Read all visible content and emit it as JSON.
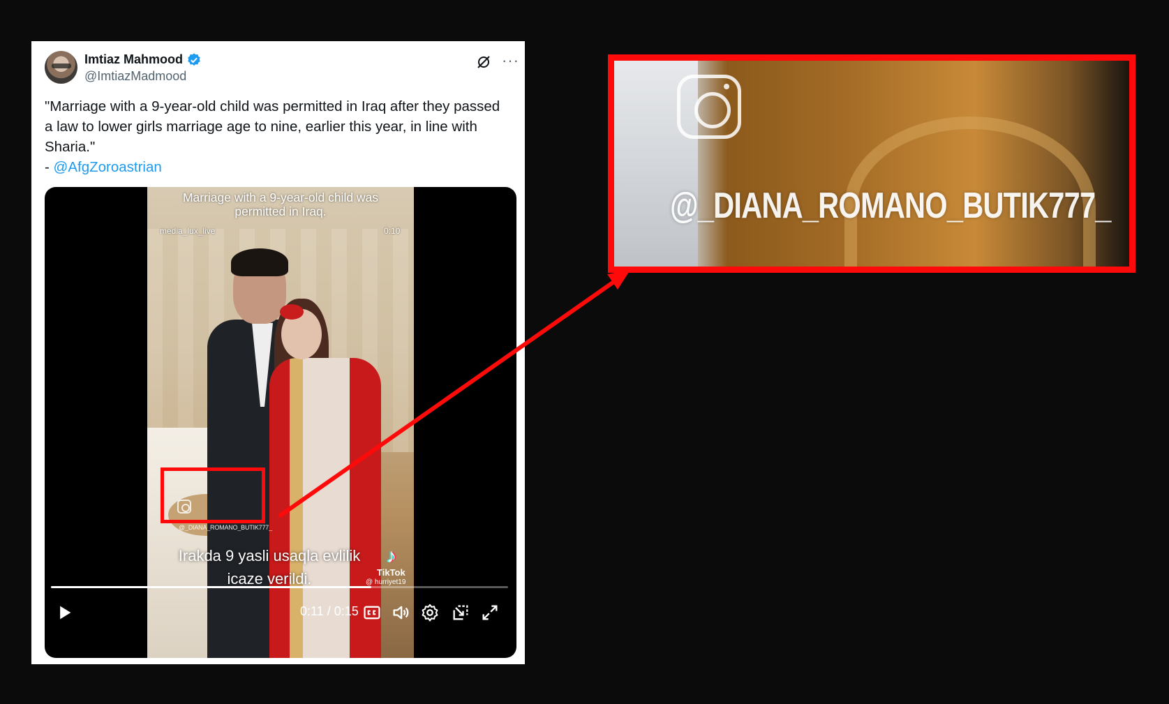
{
  "tweet": {
    "author_name": "Imtiaz Mahmood",
    "handle": "@ImtiazMadmood",
    "text_lines": [
      "\"Marriage with a 9-year-old child was permitted in Iraq after they passed",
      "a law to lower girls marriage age to nine, earlier this year, in line with",
      "Sharia.\""
    ],
    "attribution_prefix": "- ",
    "mention": "@AfgZoroastrian"
  },
  "video": {
    "caption_line1": "Marriage with a 9-year-old child was",
    "caption_line2": "permitted in Iraq.",
    "source": "media_lux_live",
    "time_badge": "0:10",
    "watermark": "@_DIANA_ROMANO_BUTIK777_",
    "overlay_line1": "Irakda 9 yasli usaqla evlilik",
    "overlay_line2": "icaze verildi.",
    "tiktok_label": "TikTok",
    "tiktok_user": "@ hurriyet19",
    "timer": "0:11 / 0:15",
    "progress": 0.7
  },
  "zoom": {
    "watermark": "@_DIANA_ROMANO_BUTIK777_"
  },
  "colors": {
    "highlight": "#ff0a0a",
    "link": "#1d9bf0",
    "verified": "#1d9bf0",
    "background": "#0b0b0b"
  },
  "icons": [
    "verified-badge-icon",
    "grok-icon",
    "more-icon",
    "instagram-icon",
    "tiktok-icon",
    "play-icon",
    "cc-icon",
    "volume-icon",
    "settings-icon",
    "popout-icon",
    "fullscreen-icon"
  ]
}
